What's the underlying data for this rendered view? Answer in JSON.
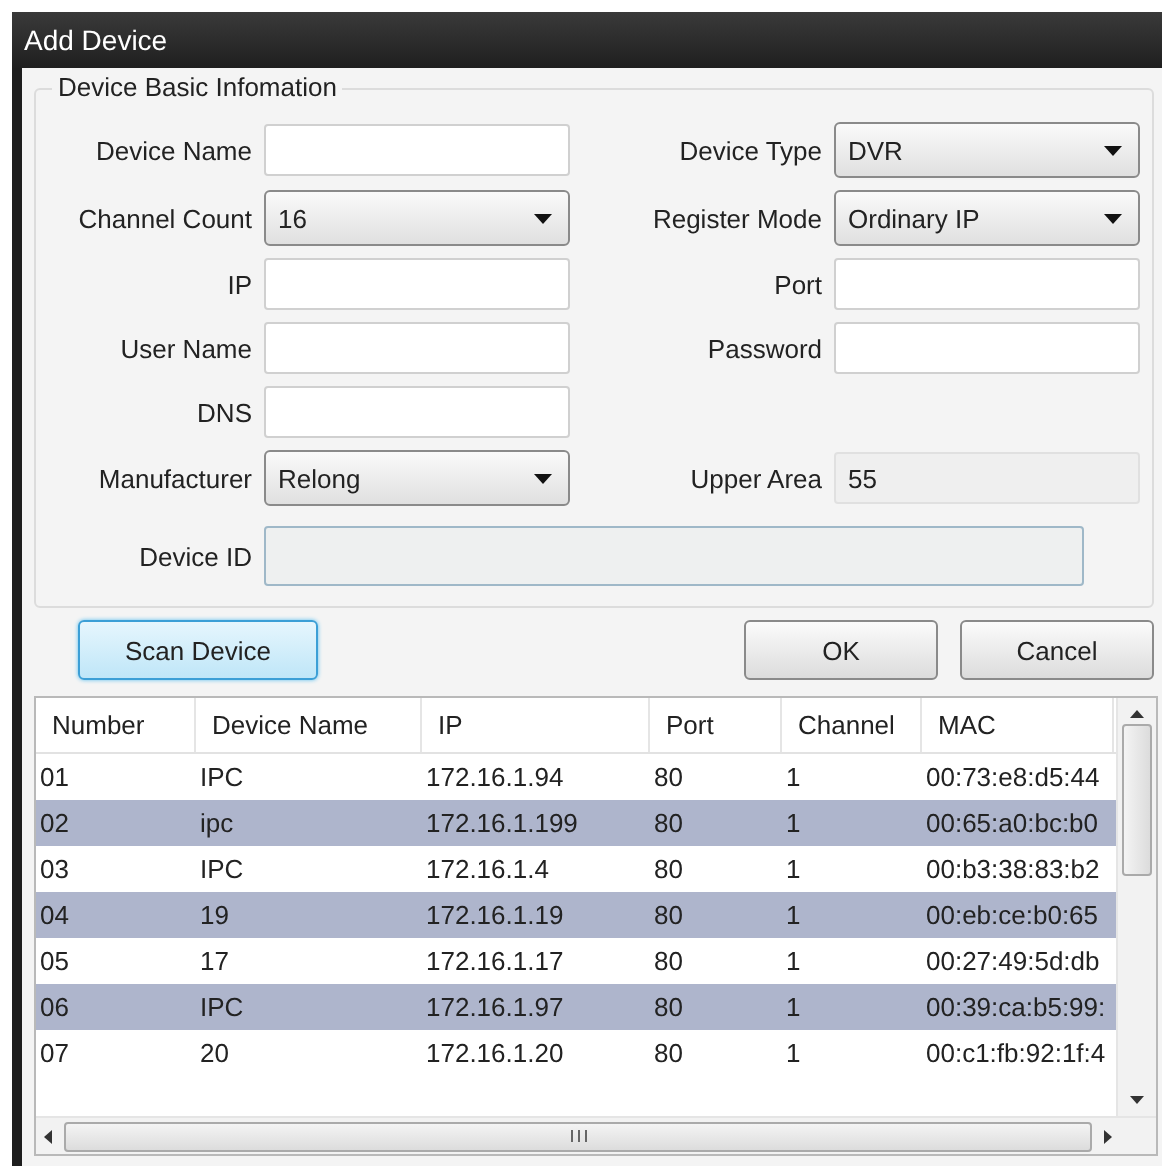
{
  "window": {
    "title": "Add Device"
  },
  "group": {
    "title": "Device Basic Infomation",
    "fields": [
      {
        "kind": "text",
        "label": "Device Name"
      },
      {
        "kind": "dropdown",
        "label": "Device Type",
        "value": "DVR"
      },
      {
        "kind": "dropdown",
        "label": "Channel Count",
        "value": "16"
      },
      {
        "kind": "dropdown",
        "label": "Register Mode",
        "value": "Ordinary IP"
      },
      {
        "kind": "text",
        "label": "IP"
      },
      {
        "kind": "text",
        "label": "Port"
      },
      {
        "kind": "text",
        "label": "User Name"
      },
      {
        "kind": "password",
        "label": "Password"
      },
      {
        "kind": "text",
        "label": "DNS"
      },
      {
        "kind": "blank"
      },
      {
        "kind": "dropdown",
        "label": "Manufacturer",
        "value": "Relong"
      },
      {
        "kind": "readonly",
        "label": "Upper Area",
        "value": "55"
      },
      {
        "kind": "wide",
        "label": "Device ID"
      }
    ]
  },
  "buttons": [
    {
      "label": "Scan Device",
      "focused": true
    },
    {
      "label": "OK",
      "focused": false
    },
    {
      "label": "Cancel",
      "focused": false
    }
  ],
  "table": {
    "columns": [
      "Number",
      "Device Name",
      "IP",
      "Port",
      "Channel",
      "MAC"
    ],
    "rows": [
      {
        "cells": [
          "01",
          "IPC",
          "172.16.1.94",
          "80",
          "1",
          "00:73:e8:d5:44"
        ],
        "selected": false
      },
      {
        "cells": [
          "02",
          "ipc",
          "172.16.1.199",
          "80",
          "1",
          "00:65:a0:bc:b0"
        ],
        "selected": true
      },
      {
        "cells": [
          "03",
          "IPC",
          "172.16.1.4",
          "80",
          "1",
          "00:b3:38:83:b2"
        ],
        "selected": false
      },
      {
        "cells": [
          "04",
          "19",
          "172.16.1.19",
          "80",
          "1",
          "00:eb:ce:b0:65"
        ],
        "selected": true
      },
      {
        "cells": [
          "05",
          "17",
          "172.16.1.17",
          "80",
          "1",
          "00:27:49:5d:db"
        ],
        "selected": false
      },
      {
        "cells": [
          "06",
          "IPC",
          "172.16.1.97",
          "80",
          "1",
          "00:39:ca:b5:99:"
        ],
        "selected": true
      },
      {
        "cells": [
          "07",
          "20",
          "172.16.1.20",
          "80",
          "1",
          "00:c1:fb:92:1f:4"
        ],
        "selected": false
      }
    ]
  }
}
